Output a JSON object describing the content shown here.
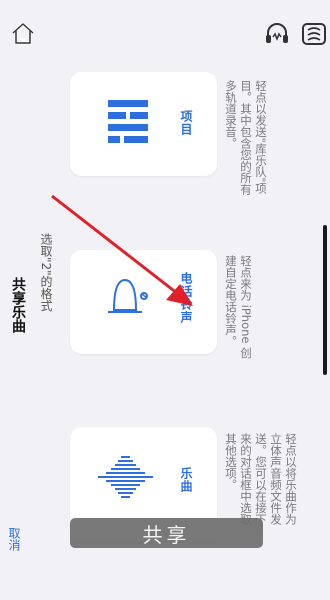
{
  "header": {
    "home_icon": "home-icon",
    "headphones_icon": "headphones-icon",
    "sound_icon": "sound-wave-icon"
  },
  "sheet": {
    "title": "共享乐曲",
    "subtitle": "选取\"2\"的格式",
    "cancel_label": "取消"
  },
  "options": [
    {
      "label": "项目",
      "icon": "tracks-icon",
      "description": "轻点以发送\"库乐队\"项目。其中包含您的所有多轨道录音。"
    },
    {
      "label": "电话铃声",
      "icon": "bell-icon",
      "description": "轻点来为 iPhone 创建自定电话铃声。"
    },
    {
      "label": "乐曲",
      "icon": "waveform-icon",
      "description": "轻点以将乐曲作为立体声音频文件发送。您可以在接下来的对话框中选取其他选项。"
    }
  ],
  "share_button": {
    "label": "共享"
  },
  "colors": {
    "accent": "#2d6fdc",
    "arrow": "#e0202a"
  }
}
